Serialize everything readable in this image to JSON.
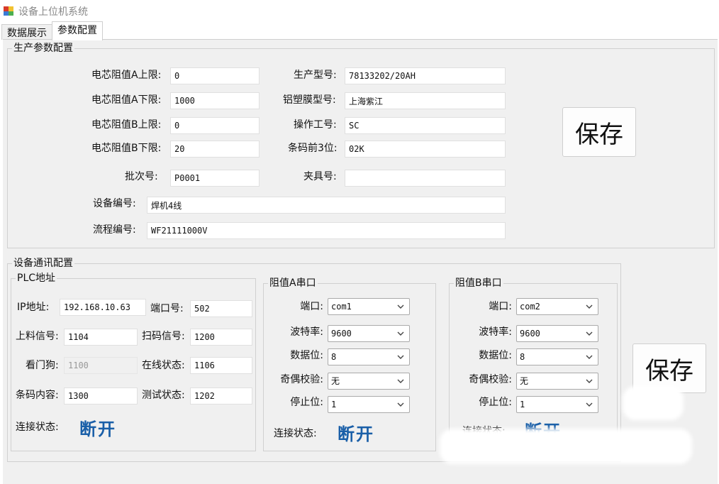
{
  "window": {
    "title": "设备上位机系统"
  },
  "tabs": [
    {
      "label": "数据展示"
    },
    {
      "label": "参数配置"
    }
  ],
  "production": {
    "title": "生产参数配置",
    "fields": {
      "cell_res_a_upper": {
        "label": "电芯阻值A上限:",
        "value": "0"
      },
      "cell_res_a_lower": {
        "label": "电芯阻值A下限:",
        "value": "1000"
      },
      "cell_res_b_upper": {
        "label": "电芯阻值B上限:",
        "value": "0"
      },
      "cell_res_b_lower": {
        "label": "电芯阻值B下限:",
        "value": "20"
      },
      "batch_no": {
        "label": "批次号:",
        "value": "P0001"
      },
      "model": {
        "label": "生产型号:",
        "value": "78133202/20AH"
      },
      "film_model": {
        "label": "铝塑膜型号:",
        "value": "上海紫江"
      },
      "operator_id": {
        "label": "操作工号:",
        "value": "SC"
      },
      "barcode_prefix": {
        "label": "条码前3位:",
        "value": "02K"
      },
      "fixture_no": {
        "label": "夹具号:",
        "value": ""
      },
      "device_no": {
        "label": "设备编号:",
        "value": "焊机4线"
      },
      "process_no": {
        "label": "流程编号:",
        "value": "WF21111000V"
      }
    },
    "save_label": "保存"
  },
  "comm": {
    "title": "设备通讯配置",
    "plc": {
      "title": "PLC地址",
      "ip": {
        "label": "IP地址:",
        "value": "192.168.10.63"
      },
      "port": {
        "label": "端口号:",
        "value": "502"
      },
      "feed_signal": {
        "label": "上料信号:",
        "value": "1104"
      },
      "scan_signal": {
        "label": "扫码信号:",
        "value": "1200"
      },
      "watchdog": {
        "label": "看门狗:",
        "value": "1100"
      },
      "online_status": {
        "label": "在线状态:",
        "value": "1106"
      },
      "barcode_content": {
        "label": "条码内容:",
        "value": "1300"
      },
      "test_status": {
        "label": "测试状态:",
        "value": "1202"
      },
      "conn_label": "连接状态:",
      "conn_value": "断开"
    },
    "serial_a": {
      "title": "阻值A串口",
      "port": {
        "label": "端口:",
        "value": "com1"
      },
      "baud": {
        "label": "波特率:",
        "value": "9600"
      },
      "databits": {
        "label": "数据位:",
        "value": "8"
      },
      "parity": {
        "label": "奇偶校验:",
        "value": "无"
      },
      "stopbits": {
        "label": "停止位:",
        "value": "1"
      },
      "conn_label": "连接状态:",
      "conn_value": "断开"
    },
    "serial_b": {
      "title": "阻值B串口",
      "port": {
        "label": "端口:",
        "value": "com2"
      },
      "baud": {
        "label": "波特率:",
        "value": "9600"
      },
      "databits": {
        "label": "数据位:",
        "value": "8"
      },
      "parity": {
        "label": "奇偶校验:",
        "value": "无"
      },
      "stopbits": {
        "label": "停止位:",
        "value": "1"
      },
      "conn_label": "连接状态:",
      "conn_value": "断开"
    },
    "save_label": "保存"
  },
  "colors": {
    "status_disconnected": "#1a5fa8",
    "panel_bg": "#f0f0f0"
  }
}
